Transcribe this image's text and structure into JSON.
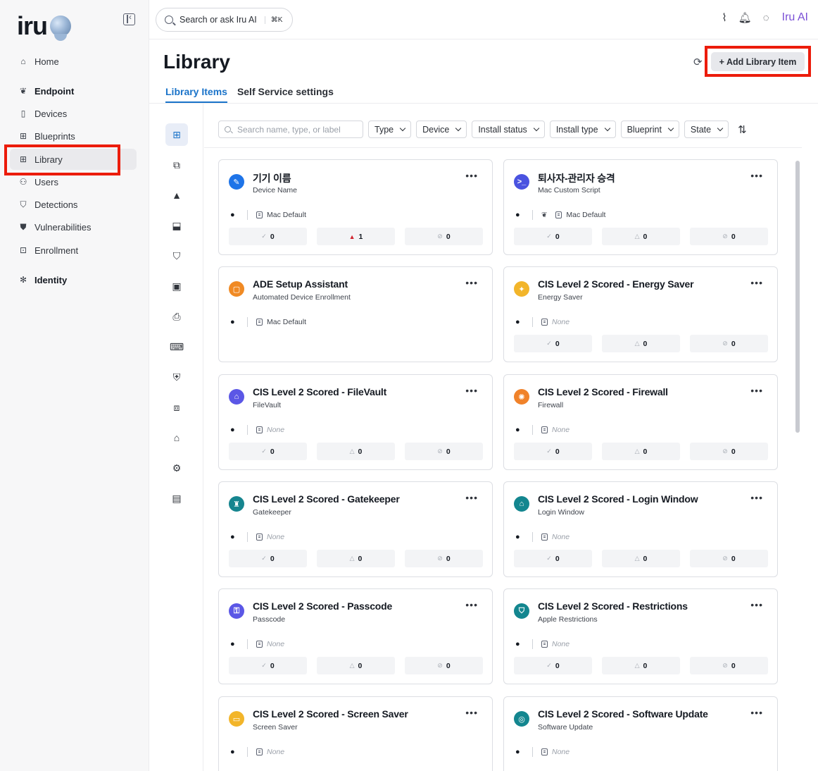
{
  "brand": {
    "name": "iru"
  },
  "sidebar": {
    "items": [
      {
        "label": "Home",
        "icon": "home-icon",
        "glyph": "⌂"
      },
      {
        "label": "Endpoint",
        "icon": "endpoint-icon",
        "glyph": "❦"
      },
      {
        "label": "Devices",
        "icon": "devices-icon",
        "glyph": "▯"
      },
      {
        "label": "Blueprints",
        "icon": "blueprints-icon",
        "glyph": "⊞"
      },
      {
        "label": "Library",
        "icon": "library-icon",
        "glyph": "⊞"
      },
      {
        "label": "Users",
        "icon": "users-icon",
        "glyph": "⚇"
      },
      {
        "label": "Detections",
        "icon": "detections-icon",
        "glyph": "⛉"
      },
      {
        "label": "Vulnerabilities",
        "icon": "vulnerabilities-icon",
        "glyph": "⛊"
      },
      {
        "label": "Enrollment",
        "icon": "enrollment-icon",
        "glyph": "⊡"
      },
      {
        "label": "Identity",
        "icon": "identity-icon",
        "glyph": "✻"
      }
    ]
  },
  "topbar": {
    "search_label": "Search or ask Iru AI",
    "shortcut": "⌘K",
    "ai_label": "Iru AI"
  },
  "page": {
    "title": "Library",
    "add_button": "+ Add Library Item",
    "tabs": [
      "Library Items",
      "Self Service settings"
    ]
  },
  "filters": {
    "search_placeholder": "Search name, type, or label",
    "dropdowns": [
      "Type",
      "Device",
      "Install status",
      "Install type",
      "Blueprint",
      "State"
    ]
  },
  "rail": [
    {
      "icon": "grid-icon",
      "glyph": "⊞"
    },
    {
      "icon": "cast-icon",
      "glyph": "⧉"
    },
    {
      "icon": "app-store-icon",
      "glyph": "▲"
    },
    {
      "icon": "custom-app-icon",
      "glyph": "⬓"
    },
    {
      "icon": "bookmark-icon",
      "glyph": "⛉"
    },
    {
      "icon": "package-icon",
      "glyph": "▣"
    },
    {
      "icon": "printer-icon",
      "glyph": "⎙"
    },
    {
      "icon": "terminal-icon",
      "glyph": "⌨"
    },
    {
      "icon": "shield-icon",
      "glyph": "⛨"
    },
    {
      "icon": "device-pair-icon",
      "glyph": "⧈"
    },
    {
      "icon": "house-icon",
      "glyph": "⌂"
    },
    {
      "icon": "settings-hand-icon",
      "glyph": "⚙"
    },
    {
      "icon": "folder-icon",
      "glyph": "▤"
    }
  ],
  "cards": [
    {
      "title": "기기 이름",
      "subtitle": "Device Name",
      "icon_color": "#1e74e8",
      "icon_glyph": "✎",
      "extra_icon": false,
      "blueprint": "Mac Default",
      "stats": [
        "0",
        "1",
        "0"
      ],
      "alert": true,
      "show_stats": true
    },
    {
      "title": "퇴사자-관리자 승격",
      "subtitle": "Mac Custom Script",
      "icon_color": "#4a53e0",
      "icon_glyph": ">_",
      "extra_icon": true,
      "blueprint": "Mac Default",
      "stats": [
        "0",
        "0",
        "0"
      ],
      "alert": false,
      "show_stats": true
    },
    {
      "title": "ADE Setup Assistant",
      "subtitle": "Automated Device Enrollment",
      "icon_color": "#f08a24",
      "icon_glyph": "▢",
      "extra_icon": false,
      "blueprint": "Mac Default",
      "stats": [],
      "alert": false,
      "show_stats": false
    },
    {
      "title": "CIS Level 2 Scored - Energy Saver",
      "subtitle": "Energy Saver",
      "icon_color": "#f2b52a",
      "icon_glyph": "✦",
      "extra_icon": false,
      "blueprint": "None",
      "stats": [
        "0",
        "0",
        "0"
      ],
      "alert": false,
      "show_stats": true
    },
    {
      "title": "CIS Level 2 Scored - FileVault",
      "subtitle": "FileVault",
      "icon_color": "#5b57e6",
      "icon_glyph": "⌂",
      "extra_icon": false,
      "blueprint": "None",
      "stats": [
        "0",
        "0",
        "0"
      ],
      "alert": false,
      "show_stats": true
    },
    {
      "title": "CIS Level 2 Scored - Firewall",
      "subtitle": "Firewall",
      "icon_color": "#f0822a",
      "icon_glyph": "✺",
      "extra_icon": false,
      "blueprint": "None",
      "stats": [
        "0",
        "0",
        "0"
      ],
      "alert": false,
      "show_stats": true
    },
    {
      "title": "CIS Level 2 Scored - Gatekeeper",
      "subtitle": "Gatekeeper",
      "icon_color": "#16858f",
      "icon_glyph": "♜",
      "extra_icon": false,
      "blueprint": "None",
      "stats": [
        "0",
        "0",
        "0"
      ],
      "alert": false,
      "show_stats": true
    },
    {
      "title": "CIS Level 2 Scored - Login Window",
      "subtitle": "Login Window",
      "icon_color": "#13868f",
      "icon_glyph": "⌂",
      "extra_icon": false,
      "blueprint": "None",
      "stats": [
        "0",
        "0",
        "0"
      ],
      "alert": false,
      "show_stats": true
    },
    {
      "title": "CIS Level 2 Scored - Passcode",
      "subtitle": "Passcode",
      "icon_color": "#5b57e6",
      "icon_glyph": "⚿",
      "extra_icon": false,
      "blueprint": "None",
      "stats": [
        "0",
        "0",
        "0"
      ],
      "alert": false,
      "show_stats": true
    },
    {
      "title": "CIS Level 2 Scored - Restrictions",
      "subtitle": "Apple Restrictions",
      "icon_color": "#13868f",
      "icon_glyph": "⛉",
      "extra_icon": false,
      "blueprint": "None",
      "stats": [
        "0",
        "0",
        "0"
      ],
      "alert": false,
      "show_stats": true
    },
    {
      "title": "CIS Level 2 Scored - Screen Saver",
      "subtitle": "Screen Saver",
      "icon_color": "#f2b52a",
      "icon_glyph": "▭",
      "extra_icon": false,
      "blueprint": "None",
      "stats": [],
      "alert": false,
      "show_stats": false
    },
    {
      "title": "CIS Level 2 Scored - Software Update",
      "subtitle": "Software Update",
      "icon_color": "#13868f",
      "icon_glyph": "◎",
      "extra_icon": false,
      "blueprint": "None",
      "stats": [],
      "alert": false,
      "show_stats": false
    }
  ]
}
